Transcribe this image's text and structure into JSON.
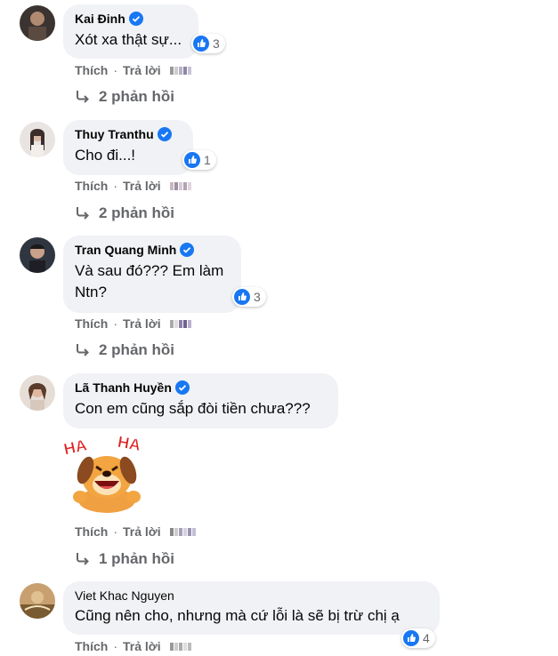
{
  "comments": [
    {
      "author": "Kai Đinh",
      "text": "Xót xa thật sự...",
      "reactions": "3",
      "like_label": "Thích",
      "reply_label": "Trả lời",
      "replies_label": "2 phản hồi"
    },
    {
      "author": "Thuy Tranthu",
      "text": "Cho đi...!",
      "reactions": "1",
      "like_label": "Thích",
      "reply_label": "Trả lời",
      "replies_label": "2 phản hồi"
    },
    {
      "author": "Tran Quang Minh",
      "text": "Và sau đó??? Em làm\nNtn?",
      "reactions": "3",
      "like_label": "Thích",
      "reply_label": "Trả lời",
      "replies_label": "2 phản hồi"
    },
    {
      "author": "Lã Thanh Huyền",
      "text": "Con em cũng sắp đòi tiền chưa???",
      "sticker_text": "HA HA",
      "like_label": "Thích",
      "reply_label": "Trả lời",
      "replies_label": "1 phản hồi"
    },
    {
      "author": "Viet Khac Nguyen",
      "text": "Cũng nên cho, nhưng mà cứ lỗi là sẽ bị trừ chị ạ",
      "reactions": "4",
      "like_label": "Thích",
      "reply_label": "Trả lời"
    }
  ],
  "icons": {
    "verified": "verified-badge-icon",
    "like": "like-reaction-icon",
    "reply_arrow": "reply-arrow-icon",
    "sticker": "haha-dog-sticker"
  },
  "colors": {
    "bubble": "#f0f2f5",
    "verified": "#1877f2",
    "like": "#1877f2",
    "secondary_text": "#65676b",
    "sticker_red": "#e02020"
  }
}
